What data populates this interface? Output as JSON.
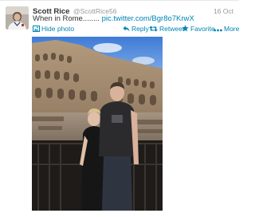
{
  "tweet": {
    "author_name": "Scott Rice",
    "screen_name": "@ScottRice56",
    "timestamp": "16 Oct",
    "text": "When in Rome........",
    "link": "pic.twitter.com/Bgr8o7KrwX"
  },
  "actions": {
    "hide_photo": "Hide photo",
    "reply": "Reply",
    "retweet": "Retweet",
    "favorite": "Favorite",
    "more": "More"
  },
  "icons": {
    "photo": "photo-icon",
    "reply": "reply-arrow-icon",
    "retweet": "retweet-icon",
    "favorite": "star-icon",
    "more": "ellipsis-icon"
  },
  "colors": {
    "link": "#0084b4",
    "muted": "#999999",
    "text": "#333333"
  }
}
